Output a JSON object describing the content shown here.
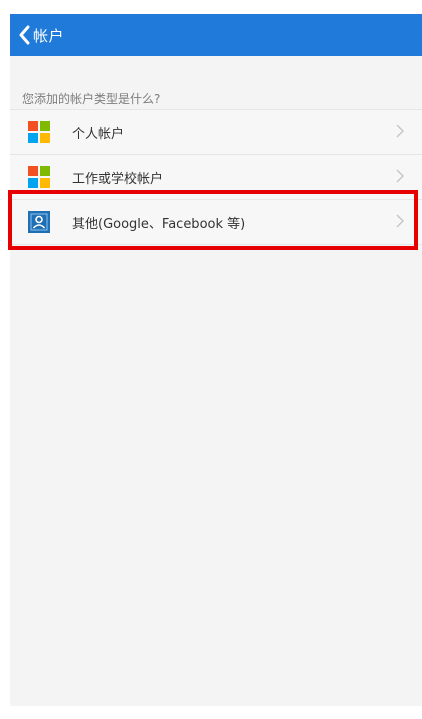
{
  "header": {
    "title": "帐户"
  },
  "prompt": "您添加的帐户类型是什么?",
  "accounts": [
    {
      "label": "个人帐户",
      "icon": "microsoft-logo-icon"
    },
    {
      "label": "工作或学校帐户",
      "icon": "microsoft-logo-icon"
    },
    {
      "label": "其他(Google、Facebook 等)",
      "icon": "person-icon"
    }
  ],
  "colors": {
    "header": "#1f7ad9",
    "highlight": "#e60000",
    "ms_red": "#f25022",
    "ms_green": "#7fba00",
    "ms_blue": "#00a4ef",
    "ms_yellow": "#ffb900",
    "person_icon": "#1f6fb5"
  }
}
